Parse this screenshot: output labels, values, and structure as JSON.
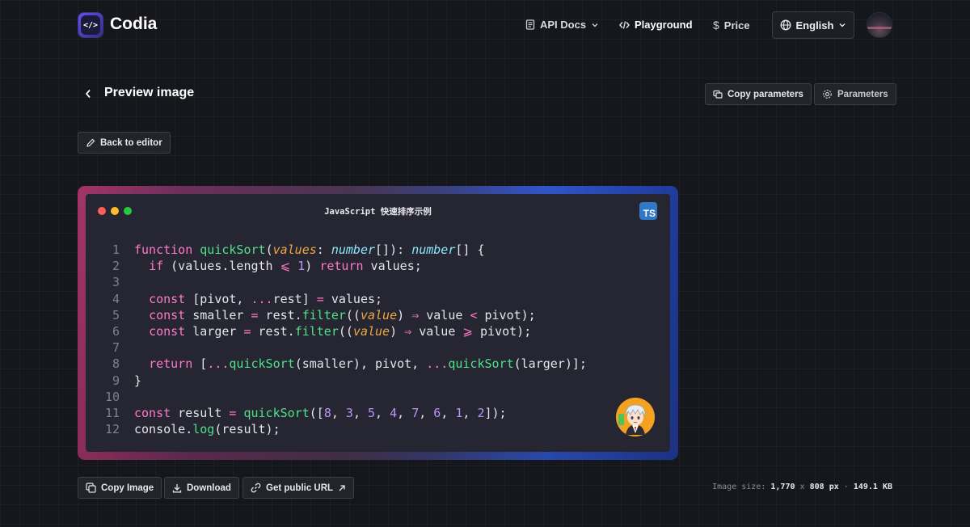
{
  "header": {
    "brand": "Codia",
    "nav": {
      "api_docs": "API Docs",
      "playground": "Playground",
      "price": "Price"
    },
    "language": "English"
  },
  "page": {
    "title": "Preview image",
    "copy_parameters": "Copy parameters",
    "parameters": "Parameters",
    "back_to_editor": "Back to editor"
  },
  "code_window": {
    "title": "JavaScript 快速排序示例",
    "badge": "TS",
    "lines": [
      {
        "n": "1",
        "tokens": [
          [
            "kw",
            "function "
          ],
          [
            "fn",
            "quickSort"
          ],
          [
            "",
            "("
          ],
          [
            "pa",
            "values"
          ],
          [
            "",
            ": "
          ],
          [
            "ty",
            "number"
          ],
          [
            "",
            "[]): "
          ],
          [
            "ty",
            "number"
          ],
          [
            "",
            "[] {"
          ]
        ]
      },
      {
        "n": "2",
        "tokens": [
          [
            "",
            "  "
          ],
          [
            "kw",
            "if"
          ],
          [
            "",
            " (values.length "
          ],
          [
            "op",
            "⩽"
          ],
          [
            "",
            " "
          ],
          [
            "nu",
            "1"
          ],
          [
            "",
            ") "
          ],
          [
            "kw",
            "return"
          ],
          [
            "",
            " values;"
          ]
        ]
      },
      {
        "n": "3",
        "tokens": []
      },
      {
        "n": "4",
        "tokens": [
          [
            "",
            "  "
          ],
          [
            "kw",
            "const"
          ],
          [
            "",
            " [pivot, "
          ],
          [
            "op",
            "..."
          ],
          [
            "",
            "rest] "
          ],
          [
            "op",
            "="
          ],
          [
            "",
            " values;"
          ]
        ]
      },
      {
        "n": "5",
        "tokens": [
          [
            "",
            "  "
          ],
          [
            "kw",
            "const"
          ],
          [
            "",
            " smaller "
          ],
          [
            "op",
            "="
          ],
          [
            "",
            " rest."
          ],
          [
            "fn",
            "filter"
          ],
          [
            "",
            "(("
          ],
          [
            "pa",
            "value"
          ],
          [
            "",
            ") "
          ],
          [
            "op",
            "⇒"
          ],
          [
            "",
            " value "
          ],
          [
            "op",
            "<"
          ],
          [
            "",
            " pivot);"
          ]
        ]
      },
      {
        "n": "6",
        "tokens": [
          [
            "",
            "  "
          ],
          [
            "kw",
            "const"
          ],
          [
            "",
            " larger "
          ],
          [
            "op",
            "="
          ],
          [
            "",
            " rest."
          ],
          [
            "fn",
            "filter"
          ],
          [
            "",
            "(("
          ],
          [
            "pa",
            "value"
          ],
          [
            "",
            ") "
          ],
          [
            "op",
            "⇒"
          ],
          [
            "",
            " value "
          ],
          [
            "op",
            "⩾"
          ],
          [
            "",
            " pivot);"
          ]
        ]
      },
      {
        "n": "7",
        "tokens": []
      },
      {
        "n": "8",
        "tokens": [
          [
            "",
            "  "
          ],
          [
            "kw",
            "return"
          ],
          [
            "",
            " ["
          ],
          [
            "op",
            "..."
          ],
          [
            "fn",
            "quickSort"
          ],
          [
            "",
            "(smaller), pivot, "
          ],
          [
            "op",
            "..."
          ],
          [
            "fn",
            "quickSort"
          ],
          [
            "",
            "(larger)];"
          ]
        ]
      },
      {
        "n": "9",
        "tokens": [
          [
            "",
            "}"
          ]
        ]
      },
      {
        "n": "10",
        "tokens": []
      },
      {
        "n": "11",
        "tokens": [
          [
            "kw",
            "const"
          ],
          [
            "",
            " result "
          ],
          [
            "op",
            "="
          ],
          [
            "",
            " "
          ],
          [
            "fn",
            "quickSort"
          ],
          [
            "",
            "(["
          ],
          [
            "nu",
            "8"
          ],
          [
            "",
            ", "
          ],
          [
            "nu",
            "3"
          ],
          [
            "",
            ", "
          ],
          [
            "nu",
            "5"
          ],
          [
            "",
            ", "
          ],
          [
            "nu",
            "4"
          ],
          [
            "",
            ", "
          ],
          [
            "nu",
            "7"
          ],
          [
            "",
            ", "
          ],
          [
            "nu",
            "6"
          ],
          [
            "",
            ", "
          ],
          [
            "nu",
            "1"
          ],
          [
            "",
            ", "
          ],
          [
            "nu",
            "2"
          ],
          [
            "",
            "]);"
          ]
        ]
      },
      {
        "n": "12",
        "tokens": [
          [
            "",
            "console."
          ],
          [
            "fn",
            "log"
          ],
          [
            "",
            "(result);"
          ]
        ]
      }
    ]
  },
  "actions": {
    "copy_image": "Copy Image",
    "download": "Download",
    "get_public_url": "Get public URL"
  },
  "image_info": {
    "label": "Image size:",
    "width": "1,770",
    "x": "x",
    "height": "808",
    "unit": "px",
    "sep": "·",
    "file_size": "149.1 KB"
  },
  "colors": {
    "background": "#15171d",
    "window": "#262633",
    "keyword": "#ff79c6",
    "function": "#50e08a",
    "type": "#8be9fd",
    "param": "#f0a840",
    "number": "#bd93f9",
    "ts_badge": "#3178c6",
    "gradient_left": "#a33468",
    "gradient_right": "#2f55c8"
  },
  "icons": {
    "api_docs": "document-icon",
    "playground": "code-icon",
    "price": "dollar-icon",
    "language": "globe-icon",
    "back": "chevron-left-icon",
    "copy_parameters": "copy-params-icon",
    "parameters": "gear-icon",
    "back_to_editor": "pencil-icon",
    "copy_image": "copy-icon",
    "download": "download-icon",
    "public_url": "link-icon",
    "external": "arrow-up-right-icon"
  }
}
